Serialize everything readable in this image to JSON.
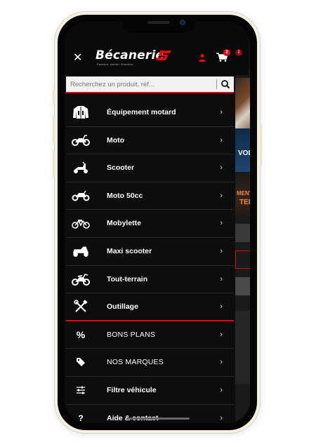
{
  "brand": {
    "name": "Bécanerie",
    "tagline": "Passion. Action. Emotion.",
    "accent": "#e30613"
  },
  "header": {
    "close_icon": "close-icon",
    "user_icon": "user-icon",
    "cart_icon": "cart-icon",
    "cart_count": "2",
    "cart_count_secondary": "2"
  },
  "search": {
    "placeholder": "Recherchez un produit, réf...",
    "button_icon": "search-icon"
  },
  "menu": {
    "items": [
      {
        "label": "Équipement motard",
        "icon": "jacket-icon"
      },
      {
        "label": "Moto",
        "icon": "motorcycle-icon"
      },
      {
        "label": "Scooter",
        "icon": "scooter-icon"
      },
      {
        "label": "Moto 50cc",
        "icon": "small-motorcycle-icon"
      },
      {
        "label": "Mobylette",
        "icon": "moped-icon"
      },
      {
        "label": "Maxi scooter",
        "icon": "maxi-scooter-icon"
      },
      {
        "label": "Tout-terrain",
        "icon": "dirt-bike-icon"
      },
      {
        "label": "Outillage",
        "icon": "tools-icon"
      },
      {
        "label": "BONS PLANS",
        "icon": "percent-icon"
      },
      {
        "label": "NOS MARQUES",
        "icon": "tag-icon"
      },
      {
        "label": "Filtre véhicule",
        "icon": "sliders-icon"
      },
      {
        "label": "Aide & contact",
        "icon": "question-icon"
      }
    ]
  },
  "background_page": {
    "peek_text_1": "VOL",
    "peek_text_2": "MENT",
    "peek_text_3": "TER"
  }
}
